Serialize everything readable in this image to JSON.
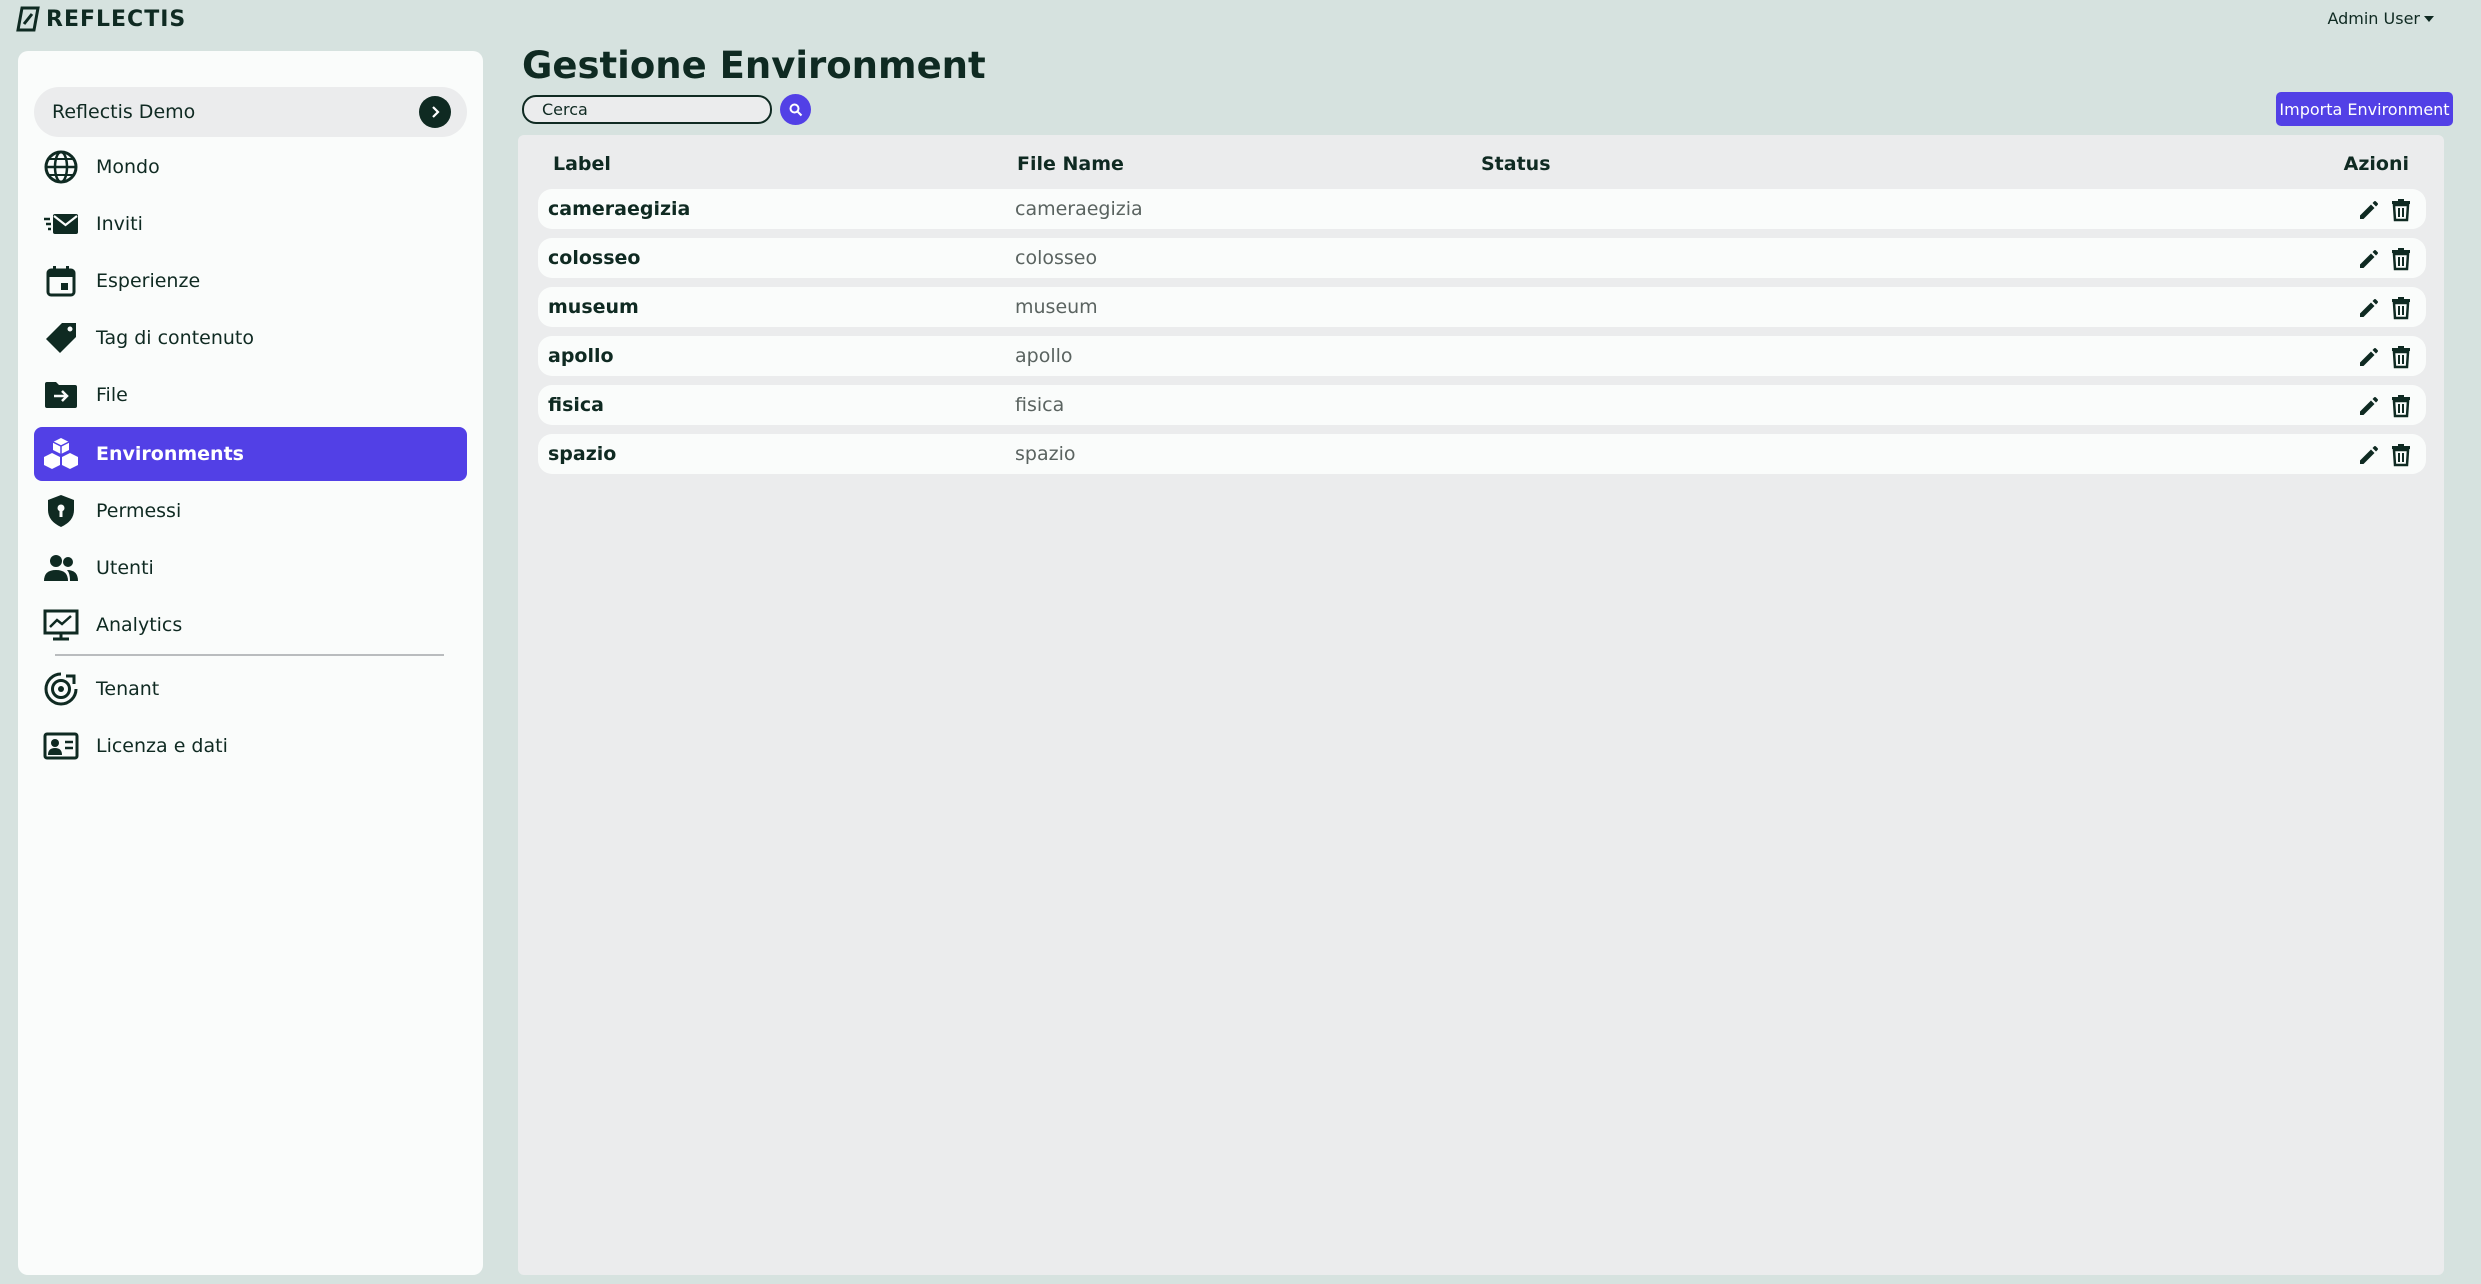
{
  "brand": {
    "name": "REFLECTIS"
  },
  "user_menu": {
    "label": "Admin User"
  },
  "sidebar": {
    "tenant": "Reflectis Demo",
    "items": [
      {
        "label": "Mondo",
        "icon": "globe-icon"
      },
      {
        "label": "Inviti",
        "icon": "mail-fast-icon"
      },
      {
        "label": "Esperienze",
        "icon": "calendar-icon"
      },
      {
        "label": "Tag di contenuto",
        "icon": "tag-icon"
      },
      {
        "label": "File",
        "icon": "folder-move-icon"
      },
      {
        "label": "Environments",
        "icon": "cubes-icon",
        "active": true
      },
      {
        "label": "Permessi",
        "icon": "shield-icon"
      },
      {
        "label": "Utenti",
        "icon": "users-icon"
      },
      {
        "label": "Analytics",
        "icon": "monitor-chart-icon"
      },
      {
        "label": "Tenant",
        "icon": "target-icon"
      },
      {
        "label": "Licenza e dati",
        "icon": "id-card-icon"
      }
    ]
  },
  "main": {
    "title": "Gestione Environment",
    "search": {
      "value": "Cerca"
    },
    "import_label": "Importa Environment",
    "columns": {
      "label": "Label",
      "file": "File Name",
      "status": "Status",
      "actions": "Azioni"
    },
    "rows": [
      {
        "label": "cameraegizia",
        "file": "cameraegizia",
        "status": ""
      },
      {
        "label": "colosseo",
        "file": "colosseo",
        "status": ""
      },
      {
        "label": "museum",
        "file": "museum",
        "status": ""
      },
      {
        "label": "apollo",
        "file": "apollo",
        "status": ""
      },
      {
        "label": "fisica",
        "file": "fisica",
        "status": ""
      },
      {
        "label": "spazio",
        "file": "spazio",
        "status": ""
      }
    ]
  },
  "colors": {
    "accent": "#5240e6",
    "dark": "#0f2a22",
    "background": "#d6e2df"
  }
}
